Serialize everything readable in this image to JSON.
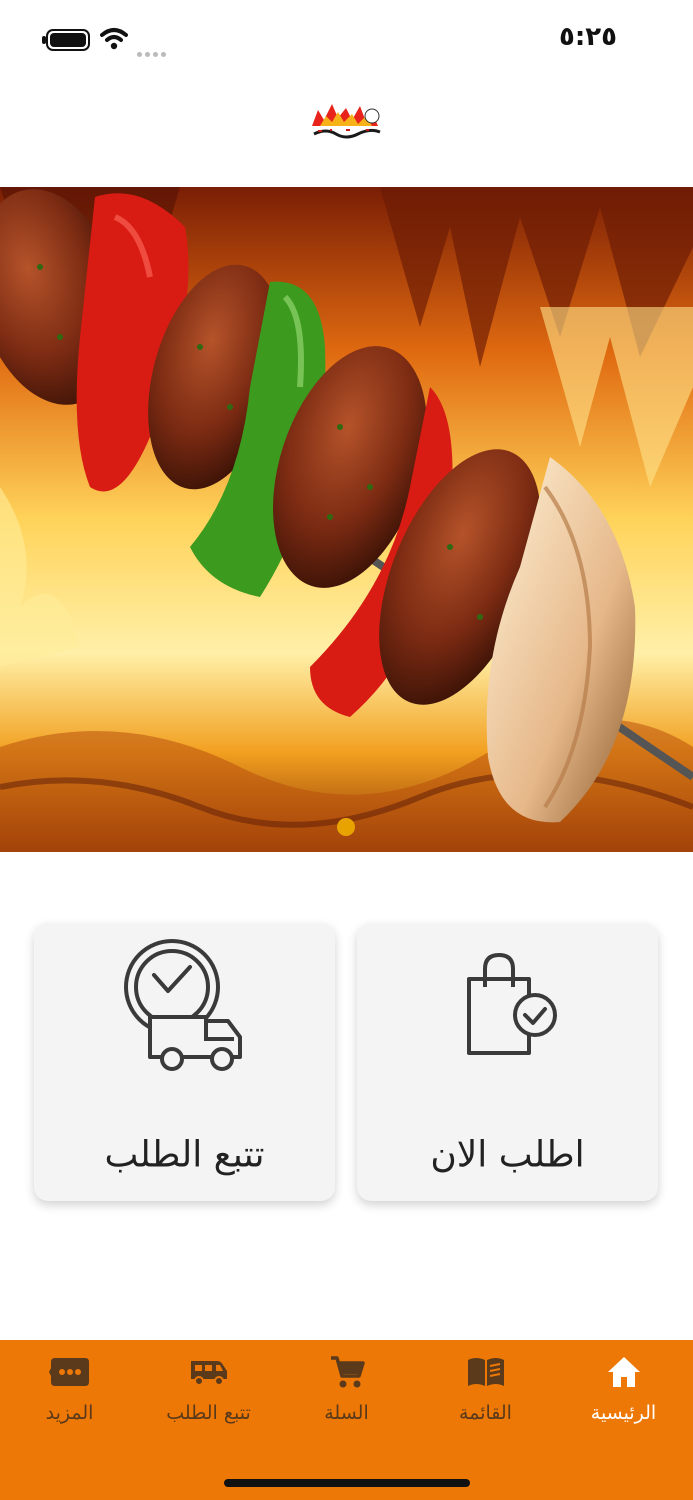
{
  "status_bar": {
    "time": "٥:٢٥"
  },
  "header": {
    "logo_icon": "restaurant-logo"
  },
  "hero": {
    "image": "kebab-skewer-over-flames",
    "page_indicator": {
      "pages": 1,
      "current": 1
    }
  },
  "actions": {
    "track_order": {
      "label": "تتبع الطلب",
      "icon": "clock-truck-icon"
    },
    "order_now": {
      "label": "اطلب الان",
      "icon": "shopping-bag-check-icon"
    }
  },
  "bottom_nav": {
    "items": [
      {
        "label": "الرئيسية",
        "icon": "home-icon",
        "active": true
      },
      {
        "label": "القائمة",
        "icon": "menu-book-icon",
        "active": false
      },
      {
        "label": "السلة",
        "icon": "cart-icon",
        "active": false
      },
      {
        "label": "تتبع الطلب",
        "icon": "delivery-van-icon",
        "active": false
      },
      {
        "label": "المزيد",
        "icon": "more-icon",
        "active": false
      }
    ]
  },
  "colors": {
    "accent": "#ee7806",
    "nav_inactive": "#5a3a1a",
    "card_bg": "#f4f4f4"
  }
}
